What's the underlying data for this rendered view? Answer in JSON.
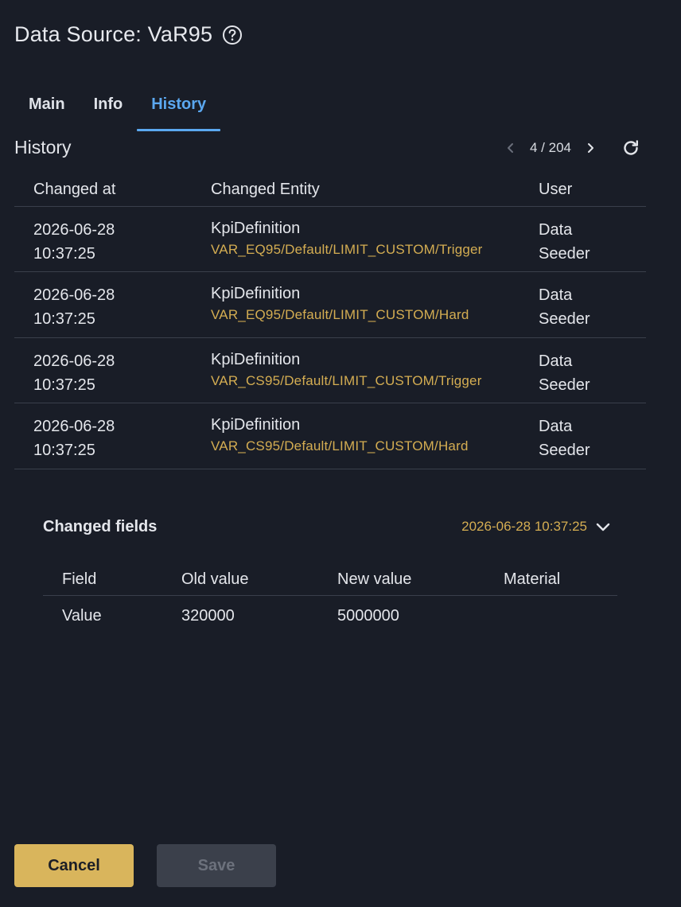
{
  "header": {
    "title": "Data Source: VaR95",
    "help_icon": "help-circle-icon"
  },
  "tabs": [
    {
      "label": "Main",
      "active": false
    },
    {
      "label": "Info",
      "active": false
    },
    {
      "label": "History",
      "active": true
    }
  ],
  "history": {
    "title": "History",
    "pager": {
      "count": "4 / 204",
      "prev_icon": "chevron-left-icon",
      "next_icon": "chevron-right-icon",
      "refresh_icon": "refresh-icon"
    },
    "columns": [
      "Changed at",
      "Changed Entity",
      "User"
    ],
    "rows": [
      {
        "date": "2026-06-28",
        "time": "10:37:25",
        "entity_type": "KpiDefinition",
        "entity_path": "VAR_EQ95/Default/LIMIT_CUSTOM/Trigger",
        "user_first": "Data",
        "user_last": "Seeder"
      },
      {
        "date": "2026-06-28",
        "time": "10:37:25",
        "entity_type": "KpiDefinition",
        "entity_path": "VAR_EQ95/Default/LIMIT_CUSTOM/Hard",
        "user_first": "Data",
        "user_last": "Seeder"
      },
      {
        "date": "2026-06-28",
        "time": "10:37:25",
        "entity_type": "KpiDefinition",
        "entity_path": "VAR_CS95/Default/LIMIT_CUSTOM/Trigger",
        "user_first": "Data",
        "user_last": "Seeder"
      },
      {
        "date": "2026-06-28",
        "time": "10:37:25",
        "entity_type": "KpiDefinition",
        "entity_path": "VAR_CS95/Default/LIMIT_CUSTOM/Hard",
        "user_first": "Data",
        "user_last": "Seeder"
      }
    ]
  },
  "changed_fields": {
    "title": "Changed fields",
    "selected_date": "2026-06-28 10:37:25",
    "columns": [
      "Field",
      "Old value",
      "New value",
      "Material"
    ],
    "rows": [
      {
        "field": "Value",
        "old": "320000",
        "new": "5000000",
        "material": ""
      }
    ]
  },
  "footer": {
    "cancel_label": "Cancel",
    "save_label": "Save"
  },
  "colors": {
    "background": "#191d27",
    "accent_blue": "#5ba8f0",
    "accent_gold": "#d4ad52",
    "button_gold": "#d9b55c"
  }
}
